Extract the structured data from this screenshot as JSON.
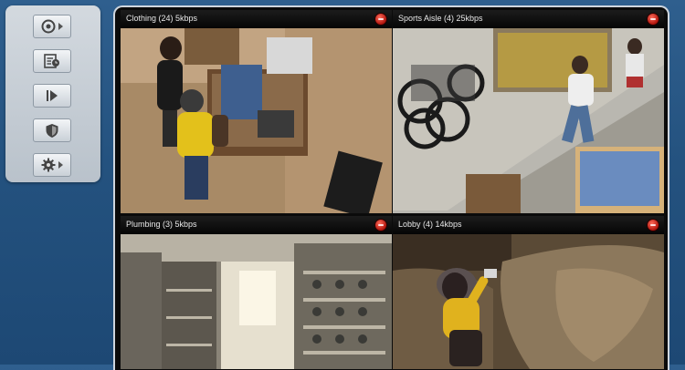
{
  "toolbar": {
    "buttons": [
      {
        "icon": "camera-icon",
        "has_menu": true
      },
      {
        "icon": "schedule-icon",
        "has_menu": false
      },
      {
        "icon": "play-icon",
        "has_menu": false
      },
      {
        "icon": "shield-icon",
        "has_menu": false
      },
      {
        "icon": "gear-icon",
        "has_menu": true
      }
    ]
  },
  "cameras": [
    {
      "title": "Clothing (24) 5kbps"
    },
    {
      "title": "Sports Aisle (4) 25kbps"
    },
    {
      "title": "Plumbing (3) 5kbps"
    },
    {
      "title": "Lobby (4) 14kbps"
    }
  ],
  "colors": {
    "background": "#24527f",
    "toolbar": "#c6cdd4",
    "close_button": "#c0180e"
  }
}
